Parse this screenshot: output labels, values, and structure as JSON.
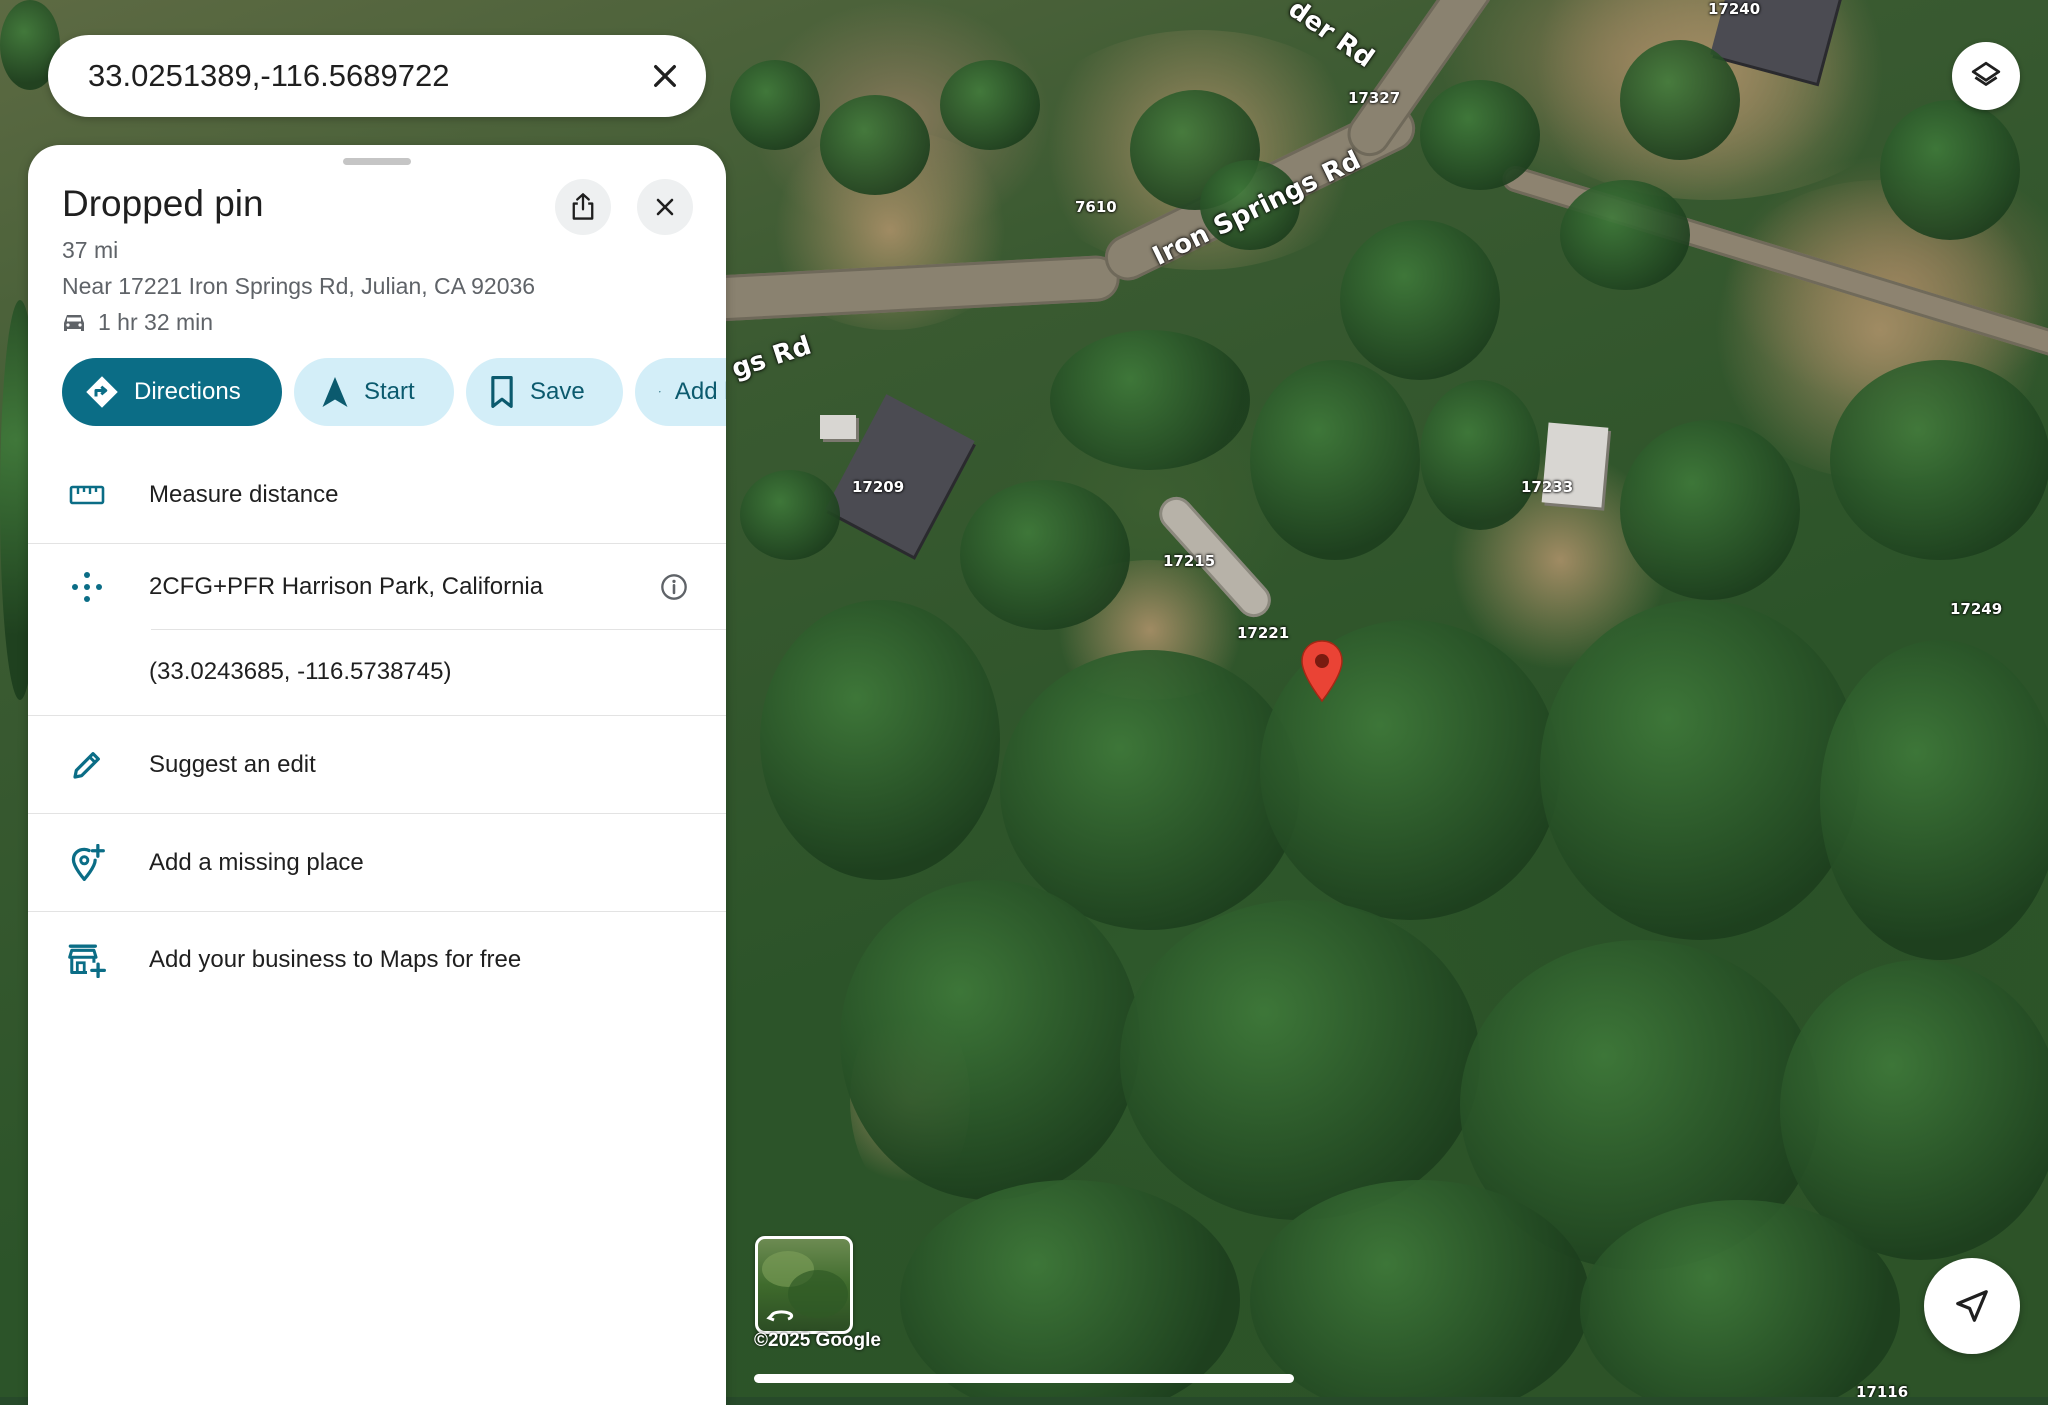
{
  "search": {
    "query": "33.0251389,-116.5689722"
  },
  "panel": {
    "title": "Dropped pin",
    "distance": "37 mi",
    "address": "Near 17221 Iron Springs Rd, Julian, CA 92036",
    "drive_time": "1 hr 32 min",
    "actions": {
      "directions": "Directions",
      "start": "Start",
      "save": "Save",
      "add_label": "Add label"
    },
    "list": {
      "measure": "Measure distance",
      "plus_code": "2CFG+PFR Harrison Park, California",
      "coordinates": "(33.0243685, -116.5738745)",
      "suggest_edit": "Suggest an edit",
      "add_missing_place": "Add a missing place",
      "add_business": "Add your business to Maps for free"
    }
  },
  "map": {
    "road_main": "Iron Springs Rd",
    "road_left": "gs Rd",
    "road_top": "der Rd",
    "address_labels": {
      "a17240": "17240",
      "a17327": "17327",
      "a7610": "7610",
      "a17209": "17209",
      "a17233": "17233",
      "a17215": "17215",
      "a17221": "17221",
      "a17249": "17249",
      "a17116": "17116"
    },
    "copyright": "©2025 Google"
  },
  "colors": {
    "accent": "#0b6d86",
    "chip_bg": "#d3eef8",
    "pin": "#ea4335"
  },
  "icons": {
    "clear": "close-icon",
    "share": "share-icon",
    "close": "close-icon",
    "car": "car-icon",
    "directions": "directions-icon",
    "start": "navigation-arrow-icon",
    "save": "bookmark-icon",
    "add_label": "flag-icon",
    "measure": "ruler-icon",
    "plus_code": "plus-code-icon",
    "info": "info-icon",
    "edit": "pencil-icon",
    "add_place": "add-location-icon",
    "add_business": "add-business-icon",
    "layers": "layers-icon",
    "locate": "my-location-arrow-icon"
  }
}
